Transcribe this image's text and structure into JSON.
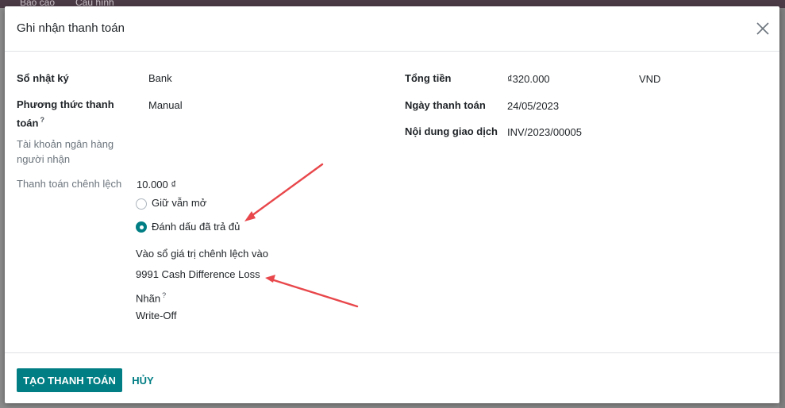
{
  "background": {
    "menu_items": [
      "Báo cáo",
      "Cấu hình"
    ]
  },
  "dialog": {
    "title": "Ghi nhận thanh toán",
    "close_icon": "close-icon"
  },
  "left": {
    "journal_label": "Sổ nhật ký",
    "journal_value": "Bank",
    "payment_method_label": "Phương thức thanh",
    "payment_method_label_2": "toán",
    "payment_method_help": "?",
    "payment_method_value": "Manual",
    "recipient_bank_label": "Tài khoản ngân hàng",
    "recipient_bank_label_2": "người nhận",
    "payment_difference_label": "Thanh toán chênh lệch",
    "payment_difference_value": "10.000 ₫",
    "options": [
      {
        "label": "Giữ vẫn mở",
        "checked": false
      },
      {
        "label": "Đánh dấu đã trả đủ",
        "checked": true
      }
    ],
    "writeoff_account_label": "Vào sổ giá trị chênh lệch vào",
    "writeoff_account_value": "9991 Cash Difference Loss",
    "label_label": "Nhãn",
    "label_help": "?",
    "label_value": "Write-Off"
  },
  "right": {
    "amount_label": "Tổng tiền",
    "amount_value": "₫320.000",
    "currency_value": "VND",
    "date_label": "Ngày thanh toán",
    "date_value": "24/05/2023",
    "memo_label": "Nội dung giao dịch",
    "memo_value": "INV/2023/00005"
  },
  "footer": {
    "create_payment": "TẠO THANH TOÁN",
    "cancel": "HỦY"
  },
  "colors": {
    "primary": "#017e84",
    "annotation_arrow": "#e8474b"
  }
}
